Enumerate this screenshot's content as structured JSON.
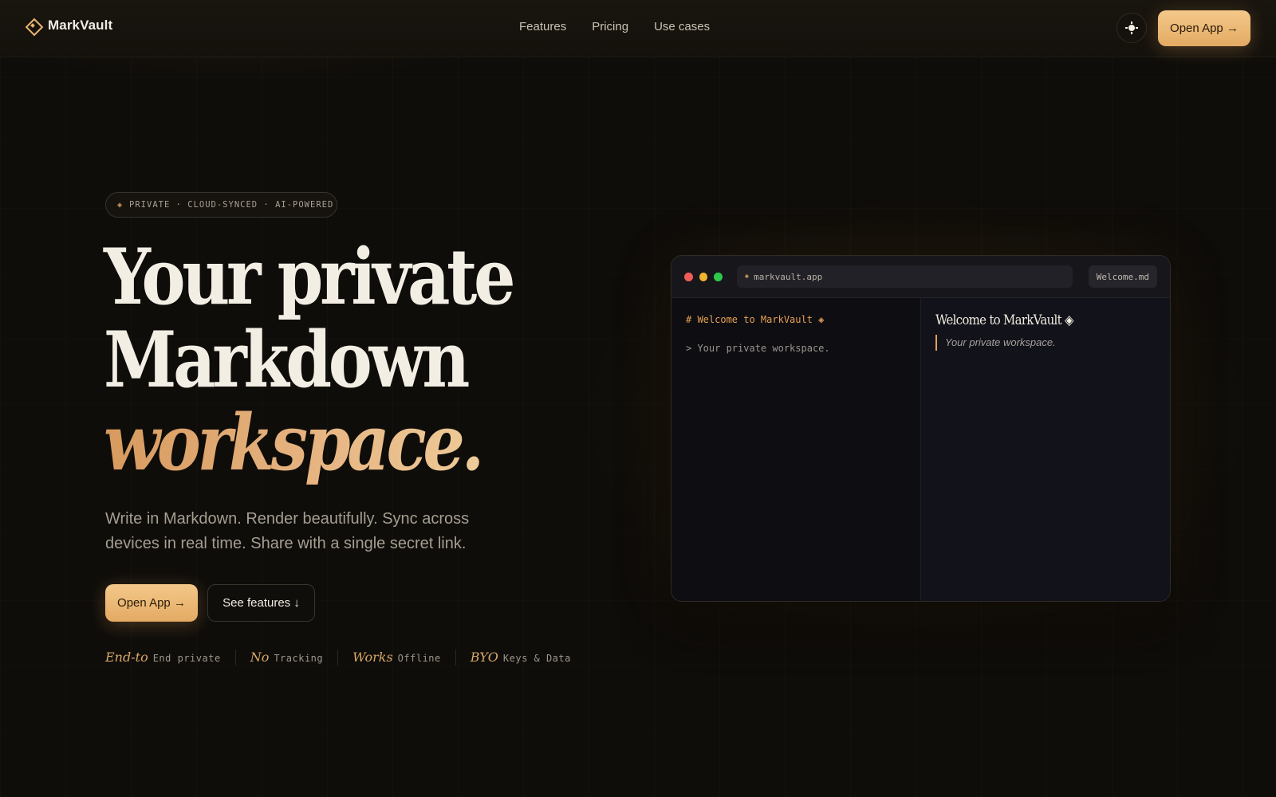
{
  "brand": {
    "name": "MarkVault"
  },
  "nav": {
    "items": [
      {
        "label": "Features"
      },
      {
        "label": "Pricing"
      },
      {
        "label": "Use cases"
      }
    ]
  },
  "header": {
    "cta_label": "Open App →"
  },
  "hero": {
    "pill": "PRIVATE · CLOUD-SYNCED · AI-POWERED",
    "headline": [
      "Your private",
      "Markdown",
      "workspace."
    ],
    "subtitle": "Write in Markdown. Render beautifully. Sync across devices in real time. Share with a single secret link.",
    "primary_cta": "Open App →",
    "secondary_cta": "See features ↓",
    "badges": [
      {
        "emphasis": "End-to",
        "text": "End private"
      },
      {
        "emphasis": "No",
        "text": "Tracking"
      },
      {
        "emphasis": "Works",
        "text": "Offline"
      },
      {
        "emphasis": "BYO",
        "text": "Keys & Data"
      }
    ]
  },
  "app_window": {
    "url": "markvault.app",
    "file_tab": "Welcome.md",
    "editor_lines": [
      "# Welcome to MarkVault ◈",
      "> Your private workspace."
    ],
    "preview_title": "Welcome to MarkVault ◈",
    "preview_quote": "Your private workspace."
  },
  "colors": {
    "accent": "#e7a053",
    "button_gradient_start": "#f4c88a",
    "button_gradient_end": "#e3aa63",
    "background": "#0f0d0a"
  },
  "icons": [
    "markvault-logo-icon",
    "sun-icon",
    "diamond-icon"
  ]
}
